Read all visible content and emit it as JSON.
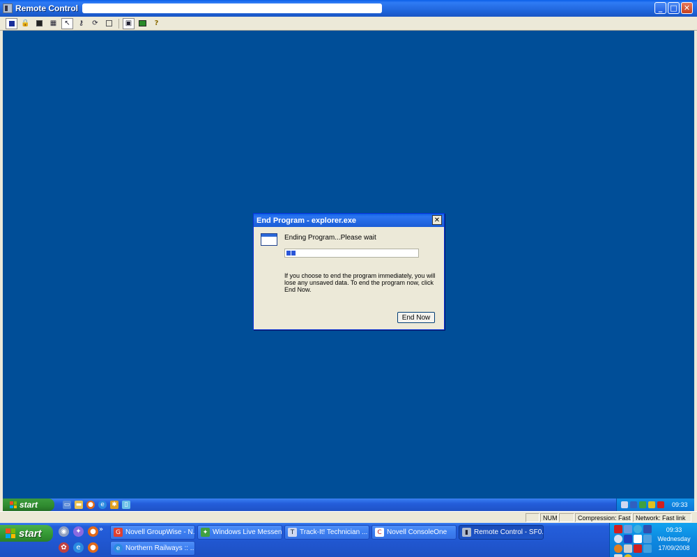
{
  "window": {
    "title": "Remote Control"
  },
  "dialog": {
    "title": "End Program - explorer.exe",
    "message": "Ending Program...Please wait",
    "warning": "If you choose to end the program immediately, you will lose any unsaved data. To end the program now, click End Now.",
    "end_now_label": "End Now",
    "progress_percent": 8
  },
  "remote_taskbar": {
    "start_label": "start",
    "clock": "09:33"
  },
  "statusbar": {
    "num": "NUM",
    "compression": "Compression: Fast",
    "network": "Network: Fast link"
  },
  "taskbar": {
    "start_label": "start",
    "tasks": [
      {
        "label": "Novell GroupWise - N..."
      },
      {
        "label": "Windows Live Messen..."
      },
      {
        "label": "Track-It! Technician ..."
      },
      {
        "label": "Novell ConsoleOne"
      },
      {
        "label": "Remote Control - SF0..."
      },
      {
        "label": "Northern Railways :: ..."
      }
    ],
    "clock": {
      "time": "09:33",
      "day": "Wednesday",
      "date": "17/09/2008"
    }
  },
  "colors": {
    "desktop": "#004e98",
    "titlebar": "#0a5fe8",
    "start_green": "#369b36",
    "taskbar_blue": "#245edb",
    "tray_blue": "#0d88e0"
  }
}
